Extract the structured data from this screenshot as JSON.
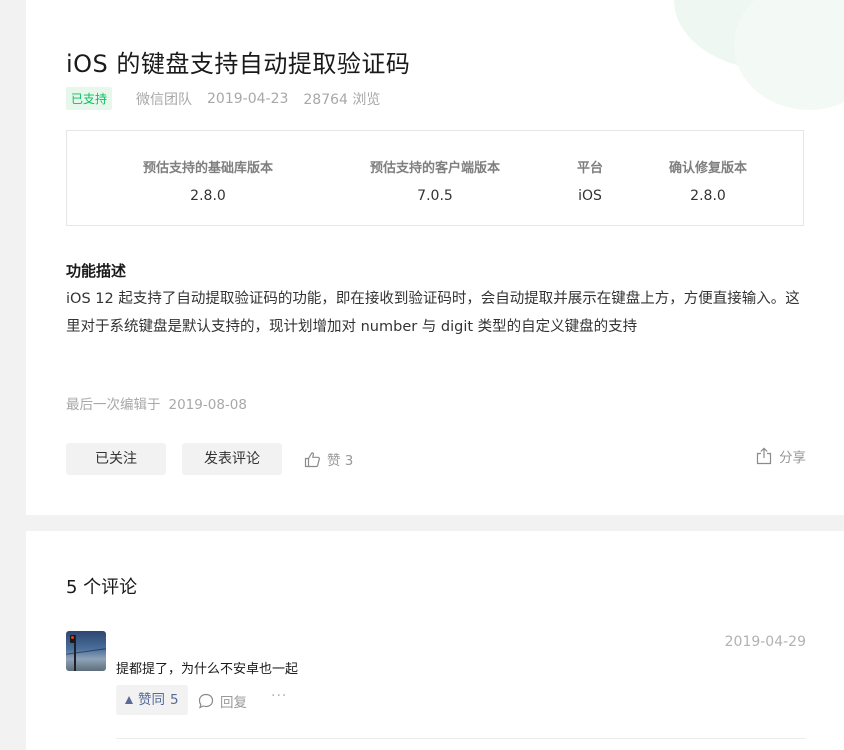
{
  "article": {
    "title": "iOS 的键盘支持自动提取验证码",
    "status_badge": "已支持",
    "author": "微信团队",
    "date": "2019-04-23",
    "views": "28764 浏览",
    "info_table": [
      {
        "label": "预估支持的基础库版本",
        "value": "2.8.0"
      },
      {
        "label": "预估支持的客户端版本",
        "value": "7.0.5"
      },
      {
        "label": "平台",
        "value": "iOS"
      },
      {
        "label": "确认修复版本",
        "value": "2.8.0"
      }
    ],
    "section_title": "功能描述",
    "description": "iOS 12 起支持了自动提取验证码的功能，即在接收到验证码时，会自动提取并展示在键盘上方，方便直接输入。这里对于系统键盘是默认支持的，现计划增加对 number 与 digit 类型的自定义键盘的支持",
    "last_edit_label": "最后一次编辑于",
    "last_edit_date": "2019-08-08",
    "follow_label": "已关注",
    "comment_label": "发表评论",
    "like_label": "赞 3",
    "share_label": "分享"
  },
  "comments": {
    "title": "5 个评论",
    "items": [
      {
        "date": "2019-04-29",
        "text": "提都提了，为什么不安卓也一起",
        "agree_label": "赞同",
        "agree_count": "5",
        "reply_label": "回复",
        "more": "···"
      }
    ]
  },
  "colors": {
    "accent_green": "#07c160",
    "link_blue": "#576b95",
    "muted_gray": "#a8a8a8"
  }
}
